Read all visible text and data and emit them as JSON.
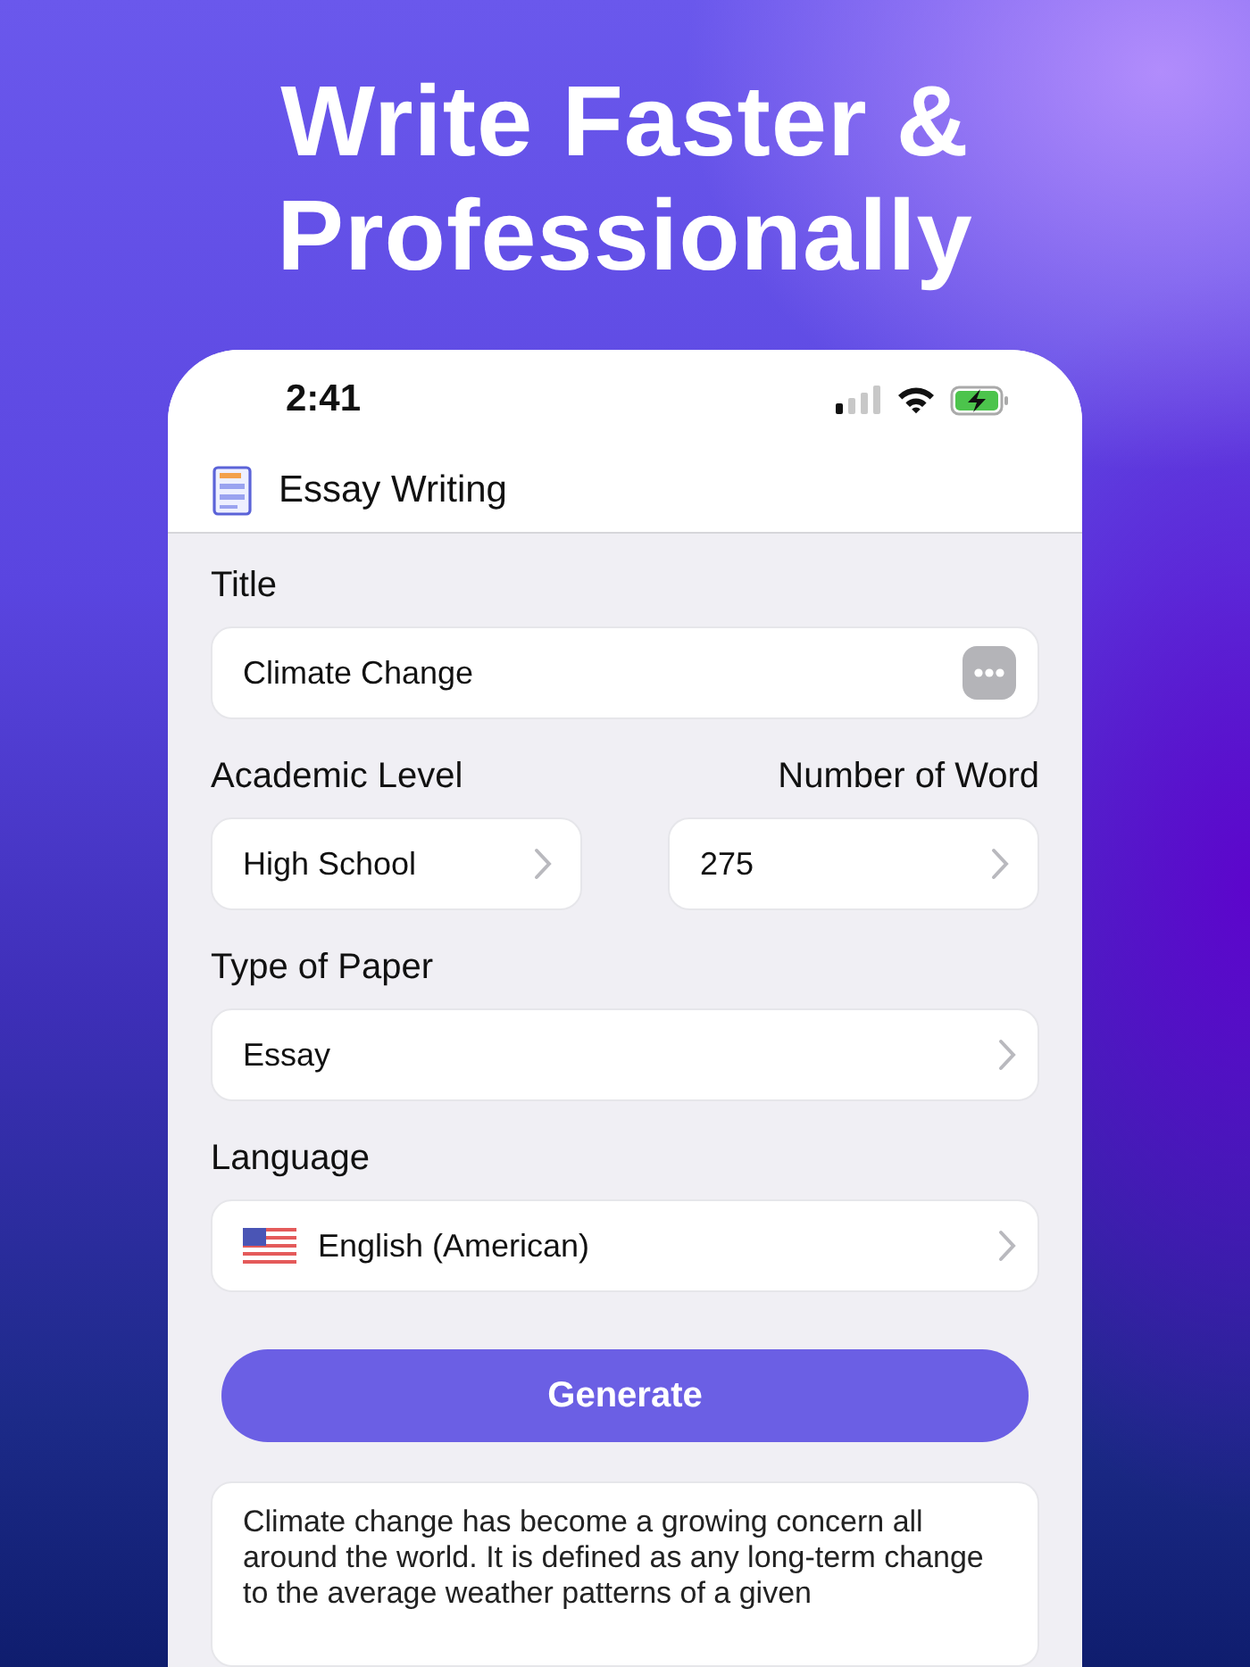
{
  "headline": "Write Faster & Professionally",
  "status_bar": {
    "time": "2:41"
  },
  "header": {
    "title": "Essay Writing"
  },
  "form": {
    "title": {
      "label": "Title",
      "value": "Climate Change"
    },
    "academic_level": {
      "label": "Academic Level",
      "value": "High School"
    },
    "number_of_words": {
      "label": "Number of Word",
      "value": "275"
    },
    "type_of_paper": {
      "label": "Type of Paper",
      "value": "Essay"
    },
    "language": {
      "label": "Language",
      "value": "English (American)"
    }
  },
  "generate_button": "Generate",
  "result_text": "Climate change has become a growing concern all around the world. It is defined as any long-term change to the average weather patterns of a given"
}
